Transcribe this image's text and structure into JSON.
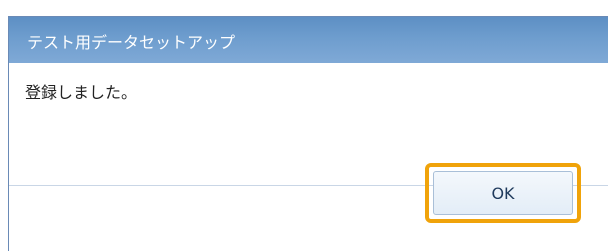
{
  "dialog": {
    "title": "テスト用データセットアップ",
    "message": "登録しました。",
    "ok_label": "OK"
  },
  "colors": {
    "titlebar": "#6e9dce",
    "highlight": "#f0a30a",
    "button_bg": "#e3edf7"
  }
}
